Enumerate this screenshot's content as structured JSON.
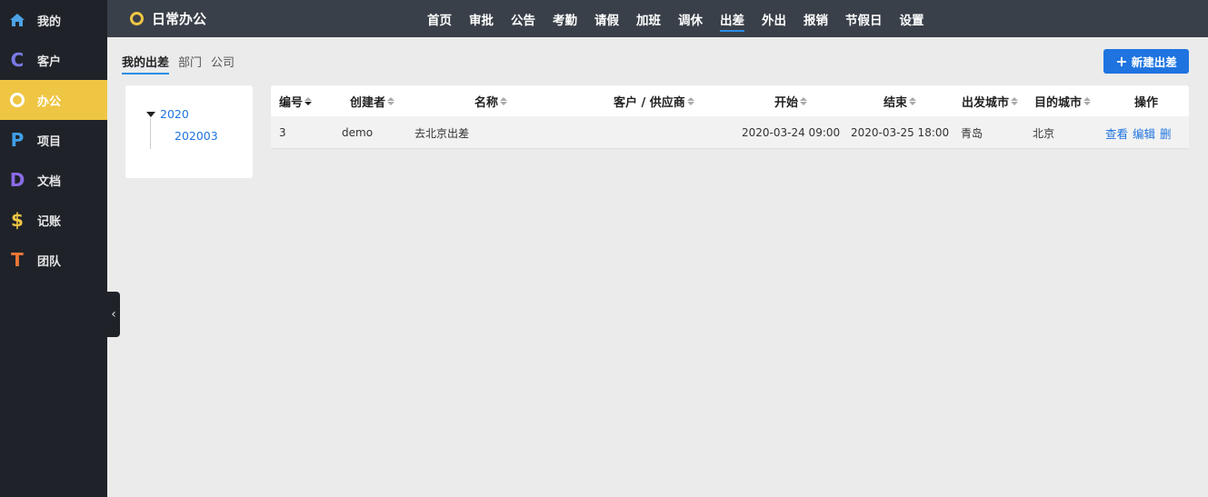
{
  "sidebar": {
    "items": [
      {
        "label": "我的",
        "icon": "home-icon",
        "glyph": "⌂",
        "color": "#4da3e6"
      },
      {
        "label": "客户",
        "icon": "c-letter-icon",
        "glyph": "C",
        "color": "#7b7be6"
      },
      {
        "label": "办公",
        "icon": "ring-icon",
        "glyph": "○",
        "color": "#ffffff"
      },
      {
        "label": "项目",
        "icon": "p-letter-icon",
        "glyph": "P",
        "color": "#3fa0e6"
      },
      {
        "label": "文档",
        "icon": "d-letter-icon",
        "glyph": "D",
        "color": "#8a6be6"
      },
      {
        "label": "记账",
        "icon": "dollar-icon",
        "glyph": "$",
        "color": "#efc644"
      },
      {
        "label": "团队",
        "icon": "t-letter-icon",
        "glyph": "T",
        "color": "#f07838"
      }
    ],
    "active_index": 2,
    "collapse_glyph": "‹"
  },
  "header": {
    "app_title": "日常办公",
    "nav": [
      "首页",
      "审批",
      "公告",
      "考勤",
      "请假",
      "加班",
      "调休",
      "出差",
      "外出",
      "报销",
      "节假日",
      "设置"
    ],
    "active_nav": "出差"
  },
  "subtabs": [
    "我的出差",
    "部门",
    "公司"
  ],
  "new_button": {
    "plus": "+",
    "label": "新建出差"
  },
  "tree": {
    "year": "2020",
    "month": "202003"
  },
  "table": {
    "columns": [
      "编号",
      "创建者",
      "名称",
      "客户 / 供应商",
      "开始",
      "结束",
      "出发城市",
      "目的城市",
      "操作"
    ],
    "rows": [
      {
        "id": "3",
        "creator": "demo",
        "name": "去北京出差",
        "client": "",
        "start": "2020-03-24 09:00",
        "end": "2020-03-25 18:00",
        "from_city": "青岛",
        "to_city": "北京",
        "actions": [
          "查看",
          "编辑",
          "删"
        ]
      }
    ]
  },
  "colors": {
    "sidebar_bg": "#1f2329",
    "active_yellow": "#efc644",
    "topbar_bg": "#3a4049",
    "accent_blue": "#1f74e0"
  }
}
